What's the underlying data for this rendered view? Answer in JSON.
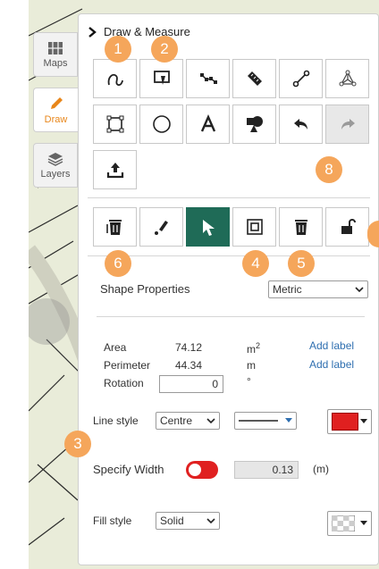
{
  "nav": {
    "maps_label": "Maps",
    "draw_label": "Draw",
    "layers_label": "Layers"
  },
  "panel": {
    "title": "Draw & Measure"
  },
  "badges": [
    "1",
    "2",
    "8",
    "6",
    "4",
    "5",
    "3"
  ],
  "props": {
    "title": "Shape Properties",
    "units_value": "Metric",
    "area_label": "Area",
    "area_value": "74.12",
    "area_unit": "m",
    "area_unit_sup": "2",
    "perimeter_label": "Perimeter",
    "perimeter_value": "44.34",
    "perimeter_unit": "m",
    "rotation_label": "Rotation",
    "rotation_value": "0",
    "rotation_unit": "°",
    "add_label": "Add label",
    "line_style_label": "Line style",
    "line_style_value": "Centre",
    "specify_width_label": "Specify Width",
    "width_value": "0.13",
    "width_unit": "(m)",
    "fill_style_label": "Fill style",
    "fill_style_value": "Solid"
  },
  "colors": {
    "accent": "#e8861a",
    "active_tool": "#1f6b57",
    "link": "#2f6fb0",
    "badge": "#f5a65b",
    "line_color": "#e02020",
    "toggle": "#e02020"
  }
}
